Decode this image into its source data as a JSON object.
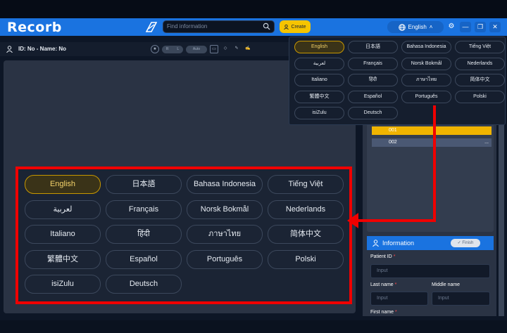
{
  "app": {
    "logo": "Recorb"
  },
  "search": {
    "placeholder": "Find information"
  },
  "create_label": "Create",
  "language": {
    "current": "English"
  },
  "patient_bar": {
    "text": "ID: No - Name: No"
  },
  "toolbar": {
    "toggle_a": "R",
    "toggle_b": "L",
    "auto": "Auto"
  },
  "tree": {
    "rows": [
      "001",
      "002"
    ],
    "more": "..."
  },
  "info": {
    "title": "Information",
    "finish": "Finish",
    "patient_id_label": "Patient ID",
    "input_placeholder": "Input",
    "last_name_label": "Last name",
    "middle_name_label": "Middle name",
    "first_name_label": "First name",
    "required_mark": "*"
  },
  "languages": [
    "English",
    "日本語",
    "Bahasa Indonesia",
    "Tiếng Việt",
    "لعربية",
    "Français",
    "Norsk Bokmål",
    "Nederlands",
    "Italiano",
    "हिंदी",
    "ภาษาไทย",
    "简体中文",
    "繁體中文",
    "Español",
    "Português",
    "Polski",
    "isiZulu",
    "Deutsch"
  ],
  "selected_language_index": 0,
  "colors": {
    "accent": "#1a73e0",
    "highlight": "#f00000",
    "selected": "#c89800",
    "create": "#f5c400"
  }
}
